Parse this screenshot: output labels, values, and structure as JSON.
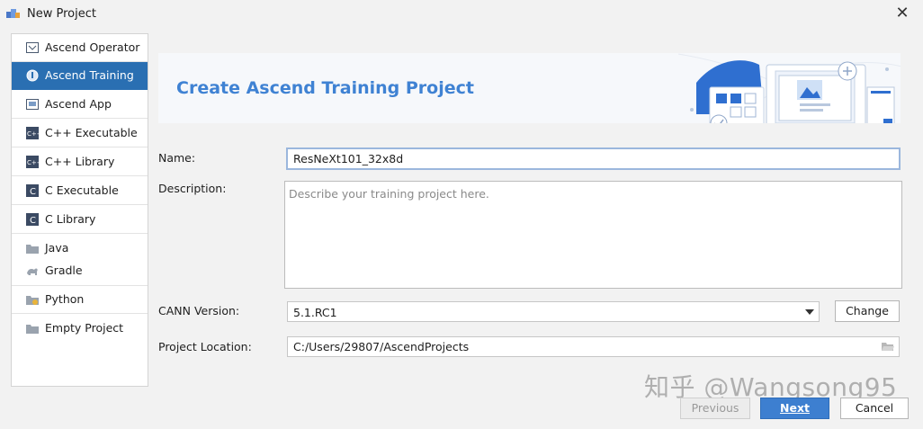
{
  "window": {
    "title": "New Project"
  },
  "sidebar": {
    "items": [
      {
        "label": "Ascend Operator",
        "icon": "ascend-operator-icon"
      },
      {
        "label": "Ascend Training",
        "icon": "ascend-training-icon",
        "selected": true
      },
      {
        "label": "Ascend App",
        "icon": "ascend-app-icon"
      },
      {
        "label": "C++ Executable",
        "icon": "cpp-executable-icon"
      },
      {
        "label": "C++ Library",
        "icon": "cpp-library-icon"
      },
      {
        "label": "C Executable",
        "icon": "c-executable-icon"
      },
      {
        "label": "C Library",
        "icon": "c-library-icon"
      },
      {
        "label": "Java",
        "icon": "java-folder-icon"
      },
      {
        "label": "Gradle",
        "icon": "gradle-icon"
      },
      {
        "label": "Python",
        "icon": "python-folder-icon"
      },
      {
        "label": "Empty Project",
        "icon": "empty-project-icon"
      }
    ]
  },
  "banner": {
    "title": "Create Ascend Training Project"
  },
  "form": {
    "name_label": "Name:",
    "name_value": "ResNeXt101_32x8d",
    "description_label": "Description:",
    "description_placeholder": "Describe your training project here.",
    "cann_label": "CANN Version:",
    "cann_value": "5.1.RC1",
    "change_button": "Change",
    "location_label": "Project Location:",
    "location_value": "C:/Users/29807/AscendProjects"
  },
  "footer": {
    "previous": "Previous",
    "next": "Next",
    "cancel": "Cancel"
  },
  "watermark": "知乎 @Wangsong95",
  "colors": {
    "selection": "#2a6fb2",
    "banner_title": "#3f82d3",
    "primary_button": "#3d7fd0"
  }
}
